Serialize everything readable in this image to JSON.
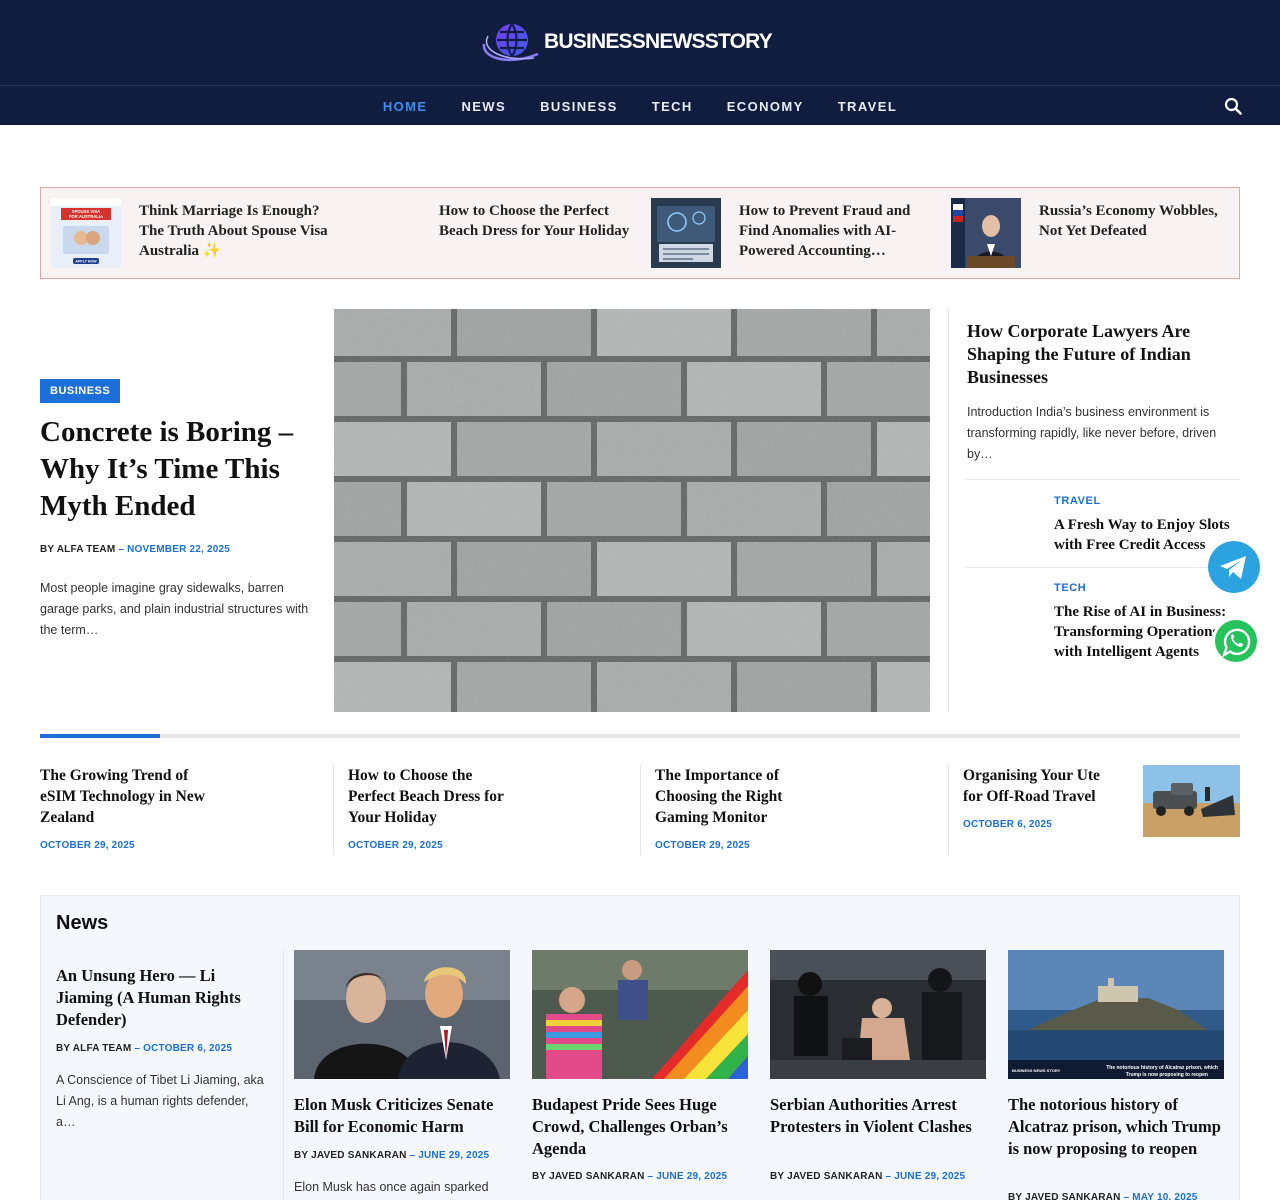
{
  "site": {
    "logo_text": "BUSINESSNEWSSTORY"
  },
  "nav": {
    "items": [
      "HOME",
      "NEWS",
      "BUSINESS",
      "TECH",
      "ECONOMY",
      "TRAVEL"
    ],
    "active": 0
  },
  "ticker": [
    {
      "title": "Think Marriage Is Enough? The Truth About Spouse Visa Australia ✨",
      "thumb_label": "SPOUSE VISA FOR AUSTRALIA",
      "thumb_cta": "APPLY NOW"
    },
    {
      "title": "How to Choose the Perfect Beach Dress for Your Holiday"
    },
    {
      "title": "How to Prevent Fraud and Find Anomalies with AI-Powered Accounting…"
    },
    {
      "title": "Russia’s Economy Wobbles, Not Yet Defeated"
    }
  ],
  "hero": {
    "category": "BUSINESS",
    "title": "Concrete is Boring – Why It’s Time This Myth Ended",
    "author_prefix": "BY",
    "author": "ALFA TEAM",
    "date": "NOVEMBER 22, 2025",
    "excerpt": "Most people imagine gray sidewalks, barren garage parks, and plain industrial structures with the term…"
  },
  "side": {
    "main": {
      "title": "How Corporate Lawyers Are Shaping the Future of Indian Businesses",
      "excerpt": "Introduction India’s business environment is transforming rapidly, like never before, driven by…"
    },
    "items": [
      {
        "category": "TRAVEL",
        "title": "A Fresh Way to Enjoy Slots with Free Credit Access"
      },
      {
        "category": "TECH",
        "title": "The Rise of AI in Business: Transforming Operations with Intelligent Agents"
      }
    ]
  },
  "slider_progress": 0.1,
  "row": [
    {
      "title": "The Growing Trend of eSIM Technology in New Zealand",
      "date": "OCTOBER 29, 2025"
    },
    {
      "title": "How to Choose the Perfect Beach Dress for Your Holiday",
      "date": "OCTOBER 29, 2025"
    },
    {
      "title": "The Importance of Choosing the Right Gaming Monitor",
      "date": "OCTOBER 29, 2025"
    },
    {
      "title": "Organising Your Ute for Off-Road Travel",
      "date": "OCTOBER 6, 2025"
    }
  ],
  "news": {
    "heading": "News",
    "lead": {
      "title": "An Unsung Hero — Li Jiaming (A Human Rights Defender)",
      "author_prefix": "BY",
      "author": "ALFA TEAM",
      "date": "OCTOBER 6, 2025",
      "excerpt": "A Conscience of Tibet Li Jiaming, aka Li Ang, is a human rights defender, a…"
    },
    "cards": [
      {
        "title": "Elon Musk Criticizes Senate Bill for Economic Harm",
        "author_prefix": "BY",
        "author": "JAVED SANKARAN",
        "date": "JUNE 29, 2025",
        "excerpt": "Elon Musk has once again sparked"
      },
      {
        "title": "Budapest Pride Sees Huge Crowd, Challenges Orban’s Agenda",
        "author_prefix": "BY",
        "author": "JAVED SANKARAN",
        "date": "JUNE 29, 2025"
      },
      {
        "title": "Serbian Authorities Arrest Protesters in Violent Clashes",
        "author_prefix": "BY",
        "author": "JAVED SANKARAN",
        "date": "JUNE 29, 2025"
      },
      {
        "title": "The notorious history of Alcatraz prison, which Trump is now proposing to reopen",
        "author_prefix": "BY",
        "author": "JAVED SANKARAN",
        "date": "MAY 10, 2025",
        "img_caption": "The notorious history of Alcatraz prison, which Trump is now proposing to reopen",
        "img_brand": "BUSINESS NEWS STORY"
      }
    ]
  },
  "colors": {
    "header_bg": "#101d3f",
    "accent": "#1c6fd8",
    "ticker_border": "#e3a7a7"
  }
}
